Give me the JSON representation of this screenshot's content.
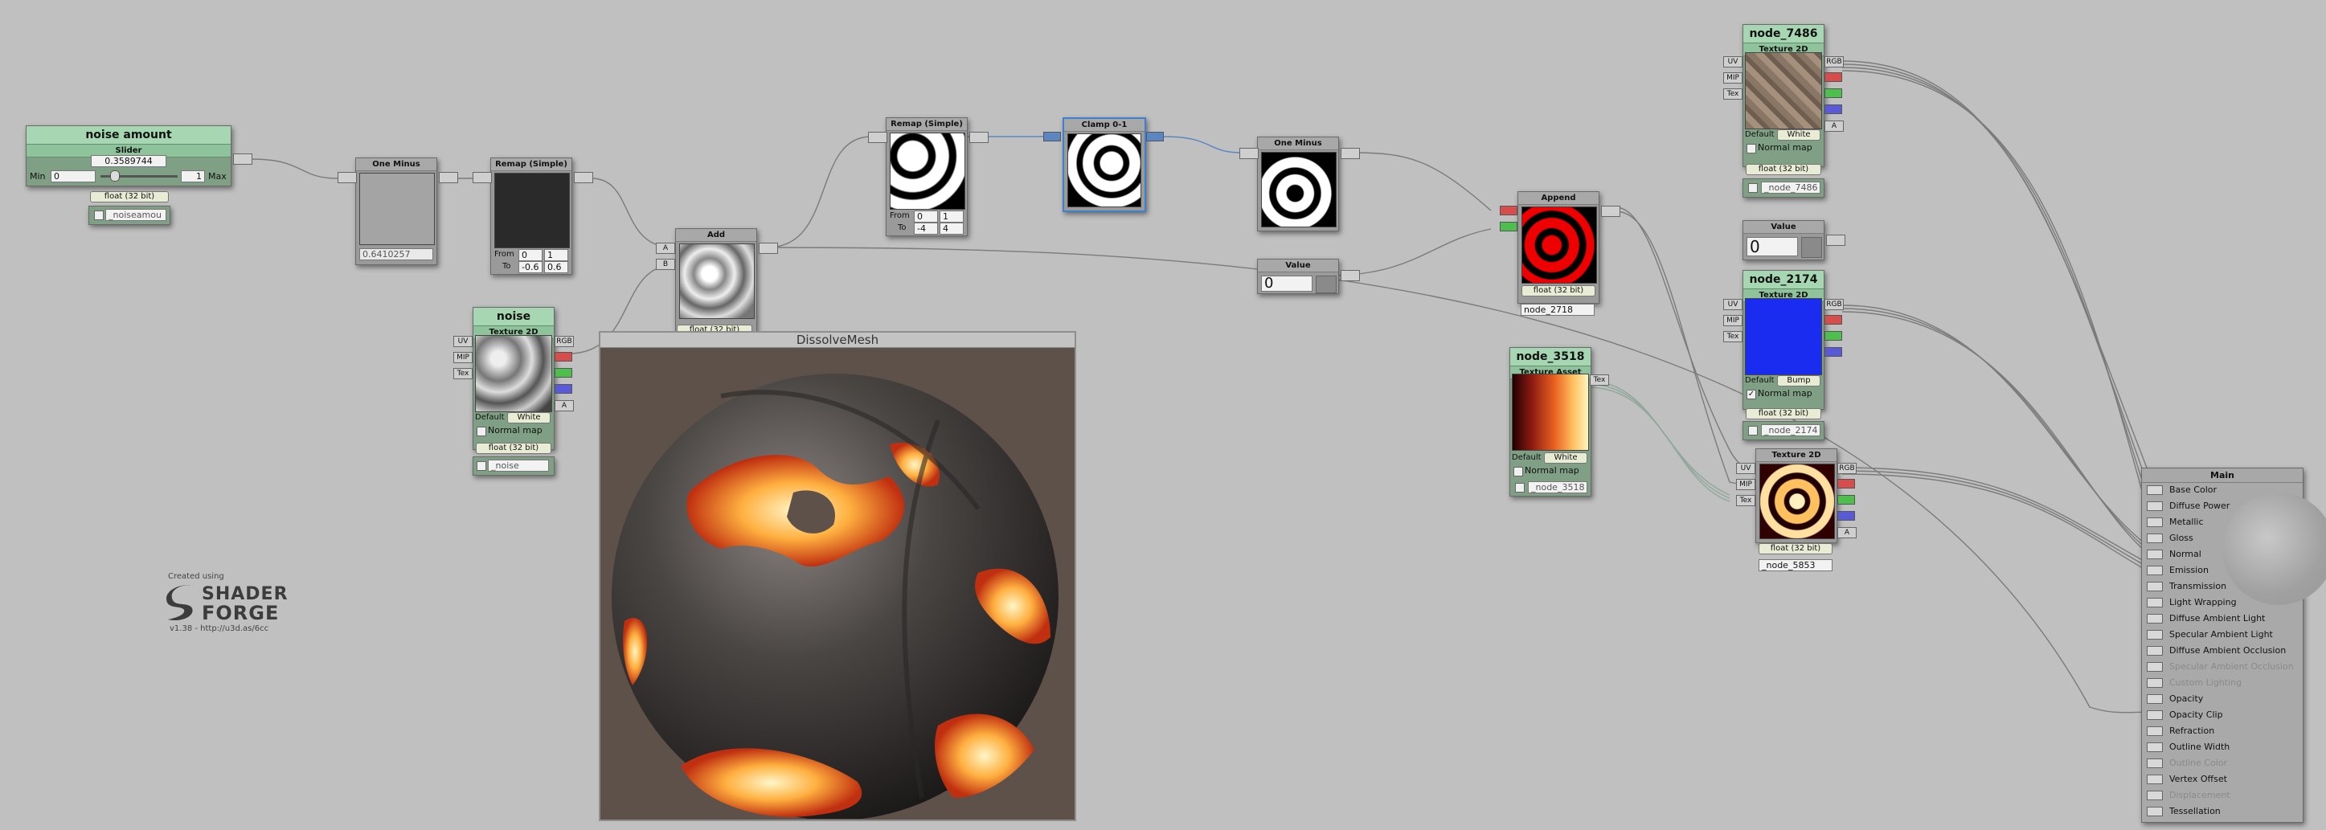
{
  "nodes": {
    "noise_amount": {
      "title": "noise amount",
      "subtitle": "Slider",
      "value": "0.3589744",
      "min_label": "Min",
      "min_value": "0",
      "max_label": "Max",
      "max_value": "1",
      "precision": "float (32 bit)",
      "prop_name": "_noiseamou"
    },
    "one_minus_1": {
      "title": "One Minus",
      "value": "0.6410257"
    },
    "remap_1": {
      "title": "Remap (Simple)",
      "from_label": "From",
      "from_a": "0",
      "from_b": "1",
      "to_label": "To",
      "to_a": "-0.6",
      "to_b": "0.6"
    },
    "noise": {
      "title": "noise",
      "subtitle": "Texture 2D",
      "ports_in": [
        "UV",
        "MIP",
        "Tex"
      ],
      "ports_out": [
        "RGB",
        "R",
        "G",
        "B",
        "A"
      ],
      "default_label": "Default",
      "default_value": "White",
      "normal_map": "Normal map",
      "precision": "float (32 bit)",
      "prop_name": "_noise"
    },
    "add": {
      "title": "Add",
      "in_a": "A",
      "in_b": "B",
      "precision": "float (32 bit)"
    },
    "remap_2": {
      "title": "Remap (Simple)",
      "from_label": "From",
      "from_a": "0",
      "from_b": "1",
      "to_label": "To",
      "to_a": "-4",
      "to_b": "4"
    },
    "clamp": {
      "title": "Clamp 0-1"
    },
    "one_minus_2": {
      "title": "One Minus"
    },
    "value_1": {
      "title": "Value",
      "value": "0"
    },
    "append": {
      "title": "Append",
      "in_r": "R",
      "in_g": "G",
      "precision": "float (32 bit)",
      "name": "node_2718"
    },
    "node_3518": {
      "title": "node_3518",
      "subtitle": "Texture Asset",
      "port_out": "Tex",
      "default_label": "Default",
      "default_value": "White",
      "normal_map": "Normal map",
      "prop_name": "_node_3518"
    },
    "node_7486": {
      "title": "node_7486",
      "subtitle": "Texture 2D",
      "ports_in": [
        "UV",
        "MIP",
        "Tex"
      ],
      "ports_out": [
        "RGB",
        "R",
        "G",
        "B",
        "A"
      ],
      "default_label": "Default",
      "default_value": "White",
      "normal_map": "Normal map",
      "precision": "float (32 bit)",
      "prop_name": "_node_7486"
    },
    "value_2": {
      "title": "Value",
      "value": "0"
    },
    "node_2174": {
      "title": "node_2174",
      "subtitle": "Texture 2D",
      "ports_in": [
        "UV",
        "MIP",
        "Tex"
      ],
      "ports_out": [
        "RGB",
        "R",
        "G",
        "B",
        "A"
      ],
      "default_label": "Default",
      "default_value": "Bump",
      "normal_map": "Normal map",
      "precision": "float (32 bit)",
      "prop_name": "_node_2174"
    },
    "tex2d_5853": {
      "title": "Texture 2D",
      "ports_in": [
        "UV",
        "MIP",
        "Tex"
      ],
      "ports_out": [
        "RGB",
        "R",
        "G",
        "B",
        "A"
      ],
      "precision": "float (32 bit)",
      "name": "_node_5853"
    }
  },
  "main": {
    "title": "Main",
    "inputs": [
      {
        "label": "Base Color",
        "enabled": true
      },
      {
        "label": "Diffuse Power",
        "enabled": true
      },
      {
        "label": "Metallic",
        "enabled": true
      },
      {
        "label": "Gloss",
        "enabled": true
      },
      {
        "label": "Normal",
        "enabled": true
      },
      {
        "label": "Emission",
        "enabled": true
      },
      {
        "label": "Transmission",
        "enabled": true
      },
      {
        "label": "Light Wrapping",
        "enabled": true
      },
      {
        "label": "Diffuse Ambient Light",
        "enabled": true
      },
      {
        "label": "Specular Ambient Light",
        "enabled": true
      },
      {
        "label": "Diffuse Ambient Occlusion",
        "enabled": true
      },
      {
        "label": "Specular Ambient Occlusion",
        "enabled": false
      },
      {
        "label": "Custom Lighting",
        "enabled": false
      },
      {
        "label": "Opacity",
        "enabled": true
      },
      {
        "label": "Opacity Clip",
        "enabled": true
      },
      {
        "label": "Refraction",
        "enabled": true
      },
      {
        "label": "Outline Width",
        "enabled": true
      },
      {
        "label": "Outline Color",
        "enabled": false
      },
      {
        "label": "Vertex Offset",
        "enabled": true
      },
      {
        "label": "Displacement",
        "enabled": false
      },
      {
        "label": "Tessellation",
        "enabled": true
      }
    ]
  },
  "preview": {
    "title": "DissolveMesh"
  },
  "logo": {
    "created": "Created using",
    "line1": "SHADER",
    "line2": "FORGE",
    "version": "v1.38 - http://u3d.as/6cc"
  },
  "colors": {
    "background": "#c0c0c0",
    "property_header": "#a7d7b2",
    "selection": "#3f7fd0",
    "port_r": "#d94c4c",
    "port_g": "#4cbf4c",
    "port_b": "#5a5ad8",
    "wire": "#7c7c7c",
    "wire_selected": "#5b86c2"
  }
}
